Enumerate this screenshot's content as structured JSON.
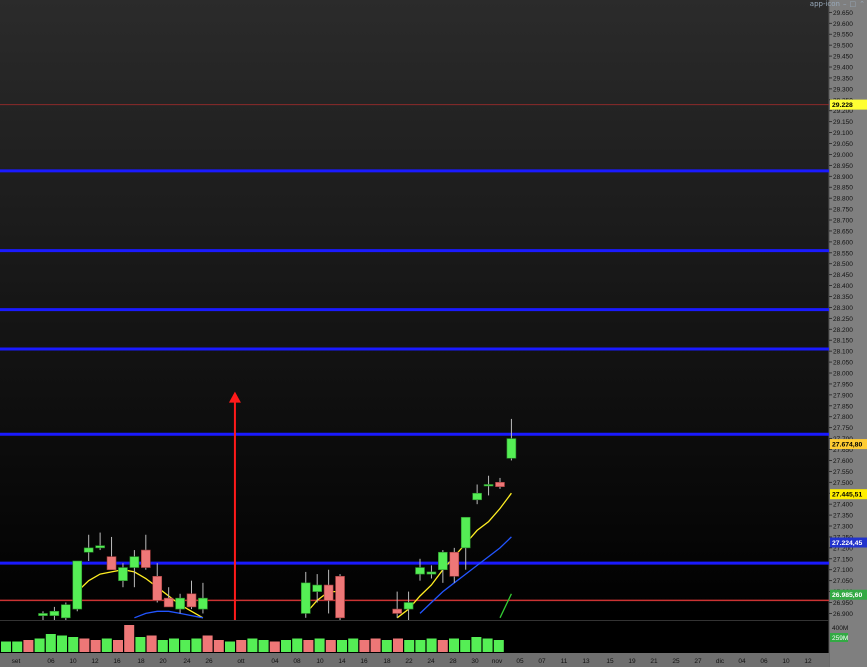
{
  "window_controls": {
    "icon": "app-icon",
    "minimize": "–",
    "restore": "□",
    "maximize": "⌃"
  },
  "volume_axis": {
    "top_label": "400M",
    "current_label": "259M"
  },
  "chart_data": {
    "type": "candlestick",
    "ylim": [
      26.87,
      29.67
    ],
    "y_ticks": [
      "29.650",
      "29.600",
      "29.550",
      "29.500",
      "29.450",
      "29.400",
      "29.350",
      "29.300",
      "29.250",
      "29.200",
      "29.150",
      "29.100",
      "29.050",
      "29.000",
      "28.950",
      "28.900",
      "28.850",
      "28.800",
      "28.750",
      "28.700",
      "28.650",
      "28.600",
      "28.550",
      "28.500",
      "28.450",
      "28.400",
      "28.350",
      "28.300",
      "28.250",
      "28.200",
      "28.150",
      "28.100",
      "28.050",
      "28.000",
      "27.950",
      "27.900",
      "27.850",
      "27.800",
      "27.750",
      "27.700",
      "27.650",
      "27.600",
      "27.550",
      "27.500",
      "27.450",
      "27.400",
      "27.350",
      "27.300",
      "27.250",
      "27.200",
      "27.150",
      "27.100",
      "27.050",
      "27.000",
      "26.950",
      "26.900"
    ],
    "x_labels": [
      "set",
      "06",
      "10",
      "12",
      "16",
      "18",
      "20",
      "24",
      "26",
      "ott",
      "04",
      "08",
      "10",
      "14",
      "16",
      "18",
      "22",
      "24",
      "28",
      "30",
      "nov",
      "05",
      "07",
      "11",
      "13",
      "15",
      "19",
      "21",
      "25",
      "27",
      "dic",
      "04",
      "06",
      "10",
      "12"
    ],
    "price_tags": [
      {
        "label": "29.228",
        "value": 29.228,
        "bg": "#ffff33",
        "fg": "#000000"
      },
      {
        "label": "27.674,80",
        "value": 27.6748,
        "bg": "#ffcc33",
        "fg": "#000000"
      },
      {
        "label": "27.445,51",
        "value": 27.4455,
        "bg": "#ffee00",
        "fg": "#000000"
      },
      {
        "label": "27.224,45",
        "value": 27.2245,
        "bg": "#2233cc",
        "fg": "#ffffff"
      },
      {
        "label": "26.985,60",
        "value": 26.9856,
        "bg": "#33aa44",
        "fg": "#ffffff"
      }
    ],
    "horizontal_lines": [
      {
        "value": 29.228,
        "color": "#8b2a2a",
        "width": 1
      },
      {
        "value": 28.925,
        "color": "#1a1aff",
        "width": 3
      },
      {
        "value": 28.56,
        "color": "#1a1aff",
        "width": 3
      },
      {
        "value": 28.29,
        "color": "#1a1aff",
        "width": 3
      },
      {
        "value": 28.11,
        "color": "#1a1aff",
        "width": 3
      },
      {
        "value": 27.72,
        "color": "#1a1aff",
        "width": 3
      },
      {
        "value": 27.13,
        "color": "#1a1aff",
        "width": 3
      },
      {
        "value": 26.96,
        "color": "#cc3333",
        "width": 1.5
      }
    ],
    "arrow": {
      "index": 19.8,
      "from": 26.87,
      "to": 27.91,
      "color": "#ff1a1a"
    },
    "candles": [
      {
        "i": 3,
        "o": 26.89,
        "h": 26.91,
        "l": 26.87,
        "c": 26.9
      },
      {
        "i": 4,
        "o": 26.89,
        "h": 26.93,
        "l": 26.87,
        "c": 26.91
      },
      {
        "i": 5,
        "o": 26.88,
        "h": 26.95,
        "l": 26.87,
        "c": 26.94
      },
      {
        "i": 6,
        "o": 26.92,
        "h": 27.06,
        "l": 26.91,
        "c": 27.14
      },
      {
        "i": 7,
        "o": 27.18,
        "h": 27.26,
        "l": 27.14,
        "c": 27.2
      },
      {
        "i": 8,
        "o": 27.2,
        "h": 27.27,
        "l": 27.19,
        "c": 27.21
      },
      {
        "i": 9,
        "o": 27.16,
        "h": 27.25,
        "l": 27.11,
        "c": 27.1
      },
      {
        "i": 10,
        "o": 27.05,
        "h": 27.13,
        "l": 27.02,
        "c": 27.11
      },
      {
        "i": 11,
        "o": 27.11,
        "h": 27.19,
        "l": 27.02,
        "c": 27.16
      },
      {
        "i": 12,
        "o": 27.19,
        "h": 27.26,
        "l": 27.1,
        "c": 27.11
      },
      {
        "i": 13,
        "o": 27.07,
        "h": 27.13,
        "l": 26.95,
        "c": 26.96
      },
      {
        "i": 14,
        "o": 26.97,
        "h": 27.02,
        "l": 26.93,
        "c": 26.93
      },
      {
        "i": 15,
        "o": 26.92,
        "h": 26.99,
        "l": 26.9,
        "c": 26.97
      },
      {
        "i": 16,
        "o": 26.99,
        "h": 27.05,
        "l": 26.92,
        "c": 26.93
      },
      {
        "i": 17,
        "o": 26.92,
        "h": 27.04,
        "l": 26.9,
        "c": 26.97
      },
      {
        "i": 26,
        "o": 26.9,
        "h": 27.09,
        "l": 26.88,
        "c": 27.04
      },
      {
        "i": 27,
        "o": 27.0,
        "h": 27.08,
        "l": 26.95,
        "c": 27.03
      },
      {
        "i": 28,
        "o": 27.03,
        "h": 27.1,
        "l": 26.9,
        "c": 26.96
      },
      {
        "i": 29,
        "o": 27.07,
        "h": 27.08,
        "l": 26.87,
        "c": 26.88
      },
      {
        "i": 34,
        "o": 26.92,
        "h": 27.0,
        "l": 26.88,
        "c": 26.9
      },
      {
        "i": 35,
        "o": 26.92,
        "h": 27.0,
        "l": 26.87,
        "c": 26.95
      },
      {
        "i": 36,
        "o": 27.08,
        "h": 27.15,
        "l": 27.05,
        "c": 27.11
      },
      {
        "i": 37,
        "o": 27.08,
        "h": 27.12,
        "l": 27.06,
        "c": 27.09
      },
      {
        "i": 38,
        "o": 27.1,
        "h": 27.19,
        "l": 27.04,
        "c": 27.18
      },
      {
        "i": 39,
        "o": 27.18,
        "h": 27.2,
        "l": 27.04,
        "c": 27.07
      },
      {
        "i": 40,
        "o": 27.2,
        "h": 27.34,
        "l": 27.1,
        "c": 27.34
      },
      {
        "i": 41,
        "o": 27.42,
        "h": 27.49,
        "l": 27.4,
        "c": 27.45
      },
      {
        "i": 42,
        "o": 27.49,
        "h": 27.53,
        "l": 27.44,
        "c": 27.49
      },
      {
        "i": 43,
        "o": 27.5,
        "h": 27.52,
        "l": 27.47,
        "c": 27.48
      },
      {
        "i": 44,
        "o": 27.61,
        "h": 27.79,
        "l": 27.6,
        "c": 27.7
      }
    ],
    "ma_yellow": [
      [
        6,
        27.0
      ],
      [
        7,
        27.05
      ],
      [
        8,
        27.08
      ],
      [
        9,
        27.09
      ],
      [
        10,
        27.1
      ],
      [
        11,
        27.09
      ],
      [
        12,
        27.06
      ],
      [
        13,
        27.02
      ],
      [
        14,
        26.98
      ],
      [
        15,
        26.94
      ],
      [
        16,
        26.91
      ],
      [
        17,
        26.88
      ],
      [
        26,
        26.9
      ],
      [
        27,
        26.96
      ],
      [
        28,
        27.0
      ],
      [
        29,
        27.0
      ],
      [
        34,
        26.88
      ],
      [
        35,
        26.92
      ],
      [
        36,
        26.98
      ],
      [
        37,
        27.03
      ],
      [
        38,
        27.1
      ],
      [
        39,
        27.16
      ],
      [
        40,
        27.22
      ],
      [
        41,
        27.28
      ],
      [
        42,
        27.32
      ],
      [
        43,
        27.38
      ],
      [
        44,
        27.45
      ]
    ],
    "ma_blue": [
      [
        11,
        26.88
      ],
      [
        12,
        26.9
      ],
      [
        13,
        26.91
      ],
      [
        14,
        26.91
      ],
      [
        15,
        26.9
      ],
      [
        16,
        26.89
      ],
      [
        17,
        26.88
      ],
      [
        36,
        26.9
      ],
      [
        37,
        26.95
      ],
      [
        38,
        27.0
      ],
      [
        39,
        27.04
      ],
      [
        40,
        27.08
      ],
      [
        41,
        27.12
      ],
      [
        42,
        27.16
      ],
      [
        43,
        27.2
      ],
      [
        44,
        27.25
      ]
    ],
    "ma_green": [
      [
        43,
        26.88
      ],
      [
        44,
        26.99
      ]
    ],
    "volumes": [
      {
        "v": 0.35,
        "up": true
      },
      {
        "v": 0.35,
        "up": true
      },
      {
        "v": 0.4,
        "up": false
      },
      {
        "v": 0.45,
        "up": true
      },
      {
        "v": 0.6,
        "up": true
      },
      {
        "v": 0.55,
        "up": true
      },
      {
        "v": 0.5,
        "up": true
      },
      {
        "v": 0.45,
        "up": false
      },
      {
        "v": 0.4,
        "up": false
      },
      {
        "v": 0.45,
        "up": true
      },
      {
        "v": 0.4,
        "up": false
      },
      {
        "v": 0.9,
        "up": false
      },
      {
        "v": 0.5,
        "up": true
      },
      {
        "v": 0.55,
        "up": false
      },
      {
        "v": 0.4,
        "up": true
      },
      {
        "v": 0.45,
        "up": true
      },
      {
        "v": 0.4,
        "up": true
      },
      {
        "v": 0.45,
        "up": true
      },
      {
        "v": 0.55,
        "up": false
      },
      {
        "v": 0.4,
        "up": false
      },
      {
        "v": 0.35,
        "up": true
      },
      {
        "v": 0.4,
        "up": false
      },
      {
        "v": 0.45,
        "up": true
      },
      {
        "v": 0.4,
        "up": true
      },
      {
        "v": 0.35,
        "up": false
      },
      {
        "v": 0.4,
        "up": true
      },
      {
        "v": 0.45,
        "up": true
      },
      {
        "v": 0.4,
        "up": false
      },
      {
        "v": 0.45,
        "up": true
      },
      {
        "v": 0.4,
        "up": false
      },
      {
        "v": 0.4,
        "up": true
      },
      {
        "v": 0.45,
        "up": true
      },
      {
        "v": 0.4,
        "up": false
      },
      {
        "v": 0.45,
        "up": false
      },
      {
        "v": 0.4,
        "up": true
      },
      {
        "v": 0.45,
        "up": false
      },
      {
        "v": 0.4,
        "up": true
      },
      {
        "v": 0.4,
        "up": true
      },
      {
        "v": 0.45,
        "up": true
      },
      {
        "v": 0.4,
        "up": false
      },
      {
        "v": 0.45,
        "up": true
      },
      {
        "v": 0.4,
        "up": true
      },
      {
        "v": 0.5,
        "up": true
      },
      {
        "v": 0.45,
        "up": true
      },
      {
        "v": 0.4,
        "up": true
      }
    ],
    "colors": {
      "up": "#55ee55",
      "down": "#ee7777",
      "wick": "#bbbbbb",
      "axis_bg": "#7f7f7f",
      "axis_text": "#111111"
    }
  }
}
